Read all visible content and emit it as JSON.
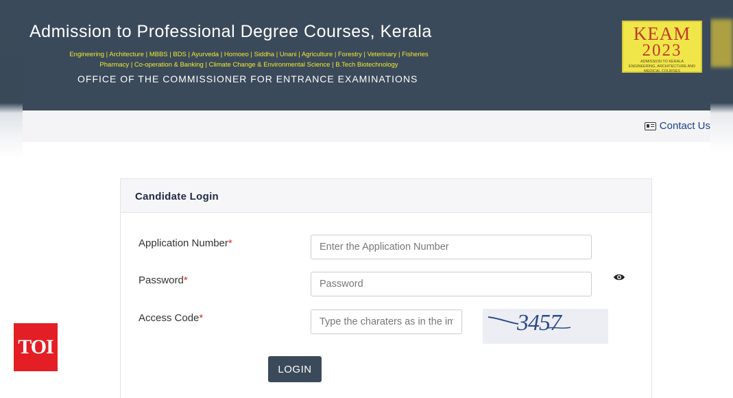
{
  "header": {
    "title": "Admission to Professional Degree Courses, Kerala",
    "courses_line1": "Engineering | Architecture | MBBS | BDS | Ayurveda | Homoeo | Siddha | Unani | Agriculture | Forestry | Veterinary | Fisheries",
    "courses_line2": "Pharmacy | Co-operation & Banking | Climate Change & Environmental Science | B.Tech Biotechnology",
    "office": "OFFICE OF THE COMMISSIONER FOR ENTRANCE EXAMINATIONS",
    "logo": {
      "name": "KEAM",
      "year": "2023",
      "subtitle": "ADMISSION TO KERALA ENGINEERING, ARCHITECTURE AND MEDICAL COURSES"
    }
  },
  "nav": {
    "contact_label": "Contact Us",
    "contact_icon": "contact-card-icon"
  },
  "login": {
    "title": "Candidate Login",
    "application_label": "Application Number",
    "application_placeholder": "Enter the Application Number",
    "password_label": "Password",
    "password_placeholder": "Password",
    "access_label": "Access Code",
    "access_placeholder": "Type the charaters as in the image",
    "required_mark": "*",
    "captcha_text": "3457",
    "password_toggle_icon": "eye-icon",
    "login_button": "LOGIN"
  },
  "watermark": {
    "text": "TOI"
  },
  "colors": {
    "header_bg": "#3b4a5b",
    "courses_text": "#f2ea2e",
    "required": "#d12b2b",
    "link": "#1a3e8c",
    "watermark_bg": "#e31e24"
  }
}
